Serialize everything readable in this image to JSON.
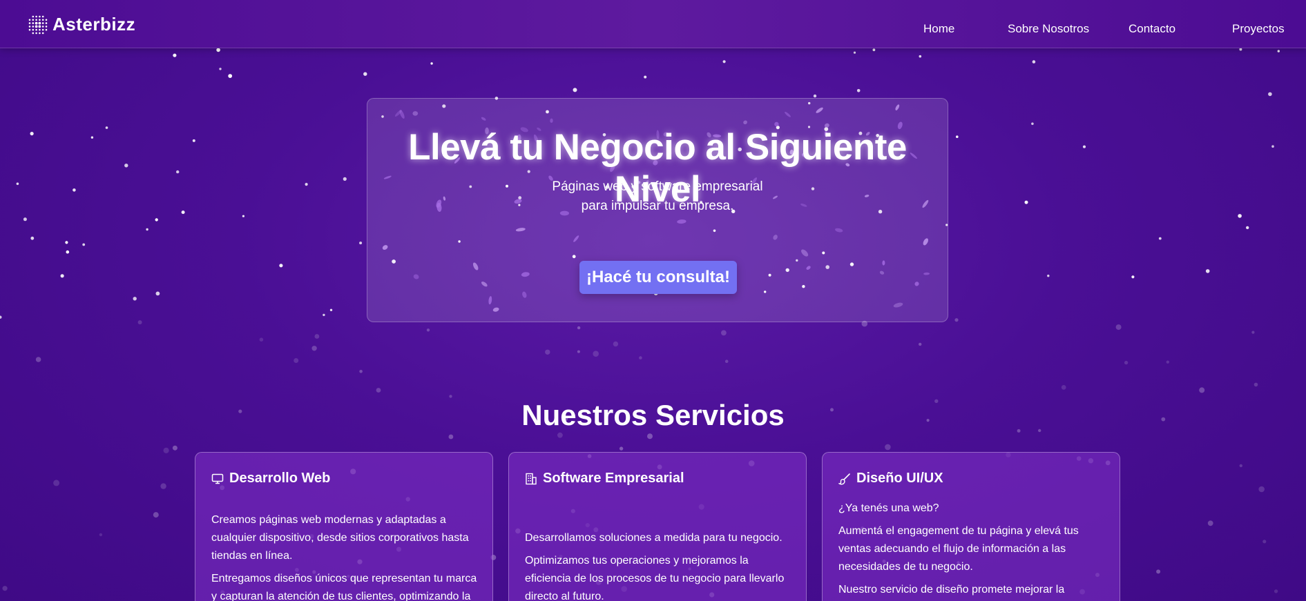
{
  "nav": {
    "brand": "Asterbizz",
    "links": [
      {
        "label": "Home"
      },
      {
        "label": "Sobre Nosotros"
      },
      {
        "label": "Contacto"
      },
      {
        "label": "Proyectos"
      }
    ]
  },
  "hero": {
    "title": "Llevá tu Negocio al Siguiente Nivel",
    "subtitle_line1": "Páginas web y software empresarial",
    "subtitle_line2": "para impulsar tu empresa.",
    "cta_label": "¡Hacé tu consulta!"
  },
  "services": {
    "title": "Nuestros Servicios",
    "cards": [
      {
        "icon": "monitor-icon",
        "title": "Desarrollo Web",
        "paragraphs": [
          "Creamos páginas web modernas y adaptadas a cualquier dispositivo, desde sitios corporativos hasta tiendas en línea.",
          "Entregamos diseños únicos que representan tu marca y capturan la atención de tus clientes, optimizando la"
        ]
      },
      {
        "icon": "building-icon",
        "title": "Software Empresarial",
        "paragraphs": [
          "Desarrollamos soluciones a medida para tu negocio.",
          "Optimizamos tus operaciones y mejoramos la eficiencia de los procesos de tu negocio para llevarlo directo al futuro."
        ]
      },
      {
        "icon": "brush-icon",
        "title": "Diseño UI/UX",
        "paragraphs": [
          "¿Ya tenés una web?",
          "Aumentá el engagement de tu página y elevá tus ventas adecuando el flujo de información a las necesidades de tu negocio.",
          "Nuestro servicio de diseño promete mejorar la"
        ]
      }
    ]
  },
  "colors": {
    "background": "#4a0f95",
    "navbar": "#5a169c",
    "cta": "#7370f2",
    "card": "#8232c8"
  }
}
